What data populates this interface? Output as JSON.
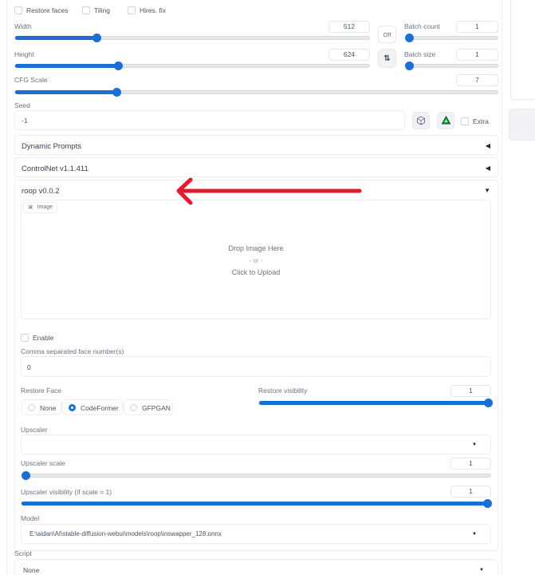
{
  "top_checkboxes": [
    {
      "label": "Restore faces",
      "checked": false
    },
    {
      "label": "Tiling",
      "checked": false
    },
    {
      "label": "Hires. fix",
      "checked": false
    }
  ],
  "sliders": {
    "width": {
      "label": "Width",
      "value": "512",
      "fraction": 0.23
    },
    "height": {
      "label": "Height",
      "value": "624",
      "fraction": 0.29
    },
    "cfg_scale": {
      "label": "CFG Scale",
      "value": "7",
      "fraction": 0.21
    },
    "batch_count": {
      "label": "Batch count",
      "value": "1",
      "fraction": 0.0
    },
    "batch_size": {
      "label": "Batch size",
      "value": "1",
      "fraction": 0.0
    }
  },
  "off_button": {
    "label": "Off"
  },
  "swap_button": {
    "icon": "swap-vertical-arrows",
    "glyph": "⇅"
  },
  "seed": {
    "label": "Seed",
    "value": "-1",
    "dice_icon": "dice-icon",
    "recycle_icon": "recycle-icon",
    "extra_label": "Extra",
    "extra_checked": false
  },
  "accordions": [
    {
      "title": "Dynamic Prompts",
      "state": "collapsed",
      "glyph": "◀"
    },
    {
      "title": "ControlNet v1.1.411",
      "state": "collapsed",
      "glyph": "◀"
    },
    {
      "title": "roop v0.0.2",
      "state": "expanded",
      "glyph": "▼"
    }
  ],
  "roop": {
    "image_tab": {
      "icon": "image-icon",
      "glyph": "▣",
      "label": "Image"
    },
    "dropzone": {
      "line1": "Drop Image Here",
      "line2": "- or -",
      "line3": "Click to Upload"
    },
    "enable": {
      "label": "Enable",
      "checked": false
    },
    "face_numbers": {
      "label": "Comma separated face number(s)",
      "value": "0"
    },
    "restore_face": {
      "label": "Restore Face",
      "options": [
        {
          "label": "None",
          "selected": false
        },
        {
          "label": "CodeFormer",
          "selected": true
        },
        {
          "label": "GFPGAN",
          "selected": false
        }
      ]
    },
    "restore_visibility": {
      "label": "Restore visibility",
      "value": "1",
      "fraction": 1.0
    },
    "upscaler": {
      "label": "Upscaler",
      "value": ""
    },
    "upscaler_scale": {
      "label": "Upscaler scale",
      "value": "1",
      "fraction": 0.0
    },
    "upscaler_visibility": {
      "label": "Upscaler visibility (if scale = 1)",
      "value": "1",
      "fraction": 1.0
    },
    "model": {
      "label": "Model",
      "value": "E:\\aidan\\AI\\stable-diffusion-webui\\models\\roop\\inswapper_128.onnx"
    }
  },
  "script": {
    "label": "Script",
    "value": "None"
  },
  "annotation": {
    "type": "arrow",
    "color": "#e31b2e",
    "points_to": "roop v0.0.2"
  },
  "colors": {
    "accent": "#1a6fd6",
    "arrow": "#e31b2e"
  }
}
